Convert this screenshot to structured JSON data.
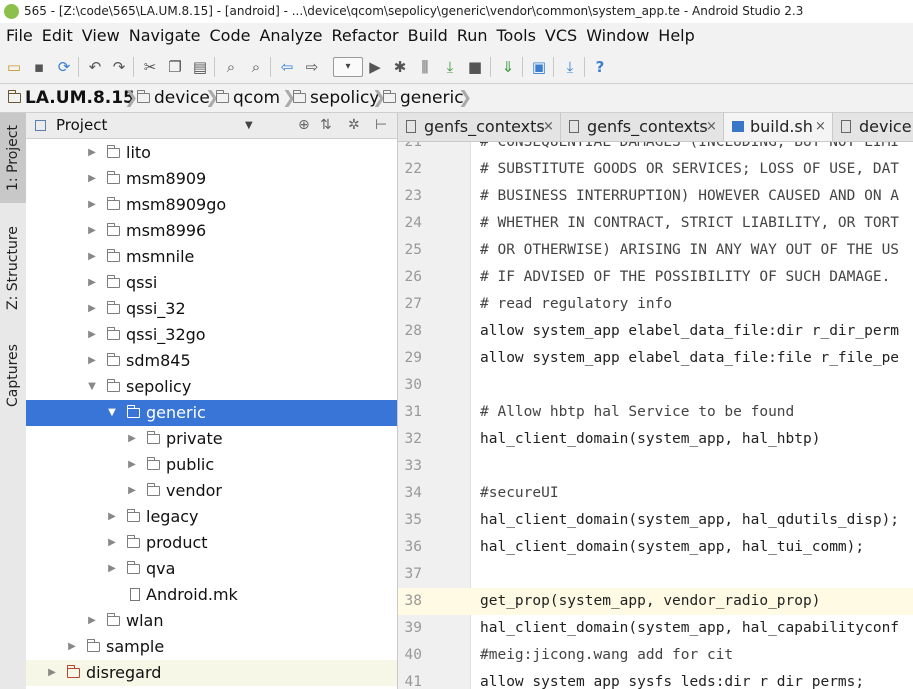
{
  "window": {
    "title": "565 - [Z:\\code\\565\\LA.UM.8.15] - [android] - ...\\device\\qcom\\sepolicy\\generic\\vendor\\common\\system_app.te - Android Studio 2.3"
  },
  "menu": [
    "File",
    "Edit",
    "View",
    "Navigate",
    "Code",
    "Analyze",
    "Refactor",
    "Build",
    "Run",
    "Tools",
    "VCS",
    "Window",
    "Help"
  ],
  "breadcrumb": [
    "LA.UM.8.15",
    "device",
    "qcom",
    "sepolicy",
    "generic"
  ],
  "side_tabs": [
    "1: Project",
    "Z: Structure",
    "Captures"
  ],
  "project_panel": {
    "title": "Project"
  },
  "tree": [
    {
      "label": "lito",
      "depth": 3,
      "type": "folder",
      "state": "collapsed"
    },
    {
      "label": "msm8909",
      "depth": 3,
      "type": "folder",
      "state": "collapsed"
    },
    {
      "label": "msm8909go",
      "depth": 3,
      "type": "folder",
      "state": "collapsed"
    },
    {
      "label": "msm8996",
      "depth": 3,
      "type": "folder",
      "state": "collapsed"
    },
    {
      "label": "msmnile",
      "depth": 3,
      "type": "folder",
      "state": "collapsed"
    },
    {
      "label": "qssi",
      "depth": 3,
      "type": "folder",
      "state": "collapsed"
    },
    {
      "label": "qssi_32",
      "depth": 3,
      "type": "folder",
      "state": "collapsed"
    },
    {
      "label": "qssi_32go",
      "depth": 3,
      "type": "folder",
      "state": "collapsed"
    },
    {
      "label": "sdm845",
      "depth": 3,
      "type": "folder",
      "state": "collapsed"
    },
    {
      "label": "sepolicy",
      "depth": 3,
      "type": "folder",
      "state": "expanded"
    },
    {
      "label": "generic",
      "depth": 4,
      "type": "folder",
      "state": "expanded",
      "selected": true
    },
    {
      "label": "private",
      "depth": 5,
      "type": "folder",
      "state": "collapsed"
    },
    {
      "label": "public",
      "depth": 5,
      "type": "folder",
      "state": "collapsed"
    },
    {
      "label": "vendor",
      "depth": 5,
      "type": "folder",
      "state": "collapsed"
    },
    {
      "label": "legacy",
      "depth": 4,
      "type": "folder",
      "state": "collapsed"
    },
    {
      "label": "product",
      "depth": 4,
      "type": "folder",
      "state": "collapsed"
    },
    {
      "label": "qva",
      "depth": 4,
      "type": "folder",
      "state": "collapsed"
    },
    {
      "label": "Android.mk",
      "depth": 4,
      "type": "file",
      "state": "none"
    },
    {
      "label": "wlan",
      "depth": 3,
      "type": "folder",
      "state": "collapsed"
    },
    {
      "label": "sample",
      "depth": 2,
      "type": "folder",
      "state": "collapsed"
    },
    {
      "label": "disregard",
      "depth": 1,
      "type": "folder",
      "state": "collapsed",
      "excluded": true
    }
  ],
  "tabs": [
    {
      "label": "genfs_contexts",
      "icon": "text-file-icon"
    },
    {
      "label": "genfs_contexts",
      "icon": "text-file-icon"
    },
    {
      "label": "build.sh",
      "icon": "shell-script-icon"
    },
    {
      "label": "device.",
      "icon": "text-file-icon"
    }
  ],
  "editor": {
    "current_line": 38,
    "lines": [
      {
        "num": "21",
        "text": "# CONSEQUENTIAL DAMAGES (INCLUDING, BUT NOT LIMI"
      },
      {
        "num": "22",
        "text": "# SUBSTITUTE GOODS OR SERVICES; LOSS OF USE, DAT"
      },
      {
        "num": "23",
        "text": "# BUSINESS INTERRUPTION) HOWEVER CAUSED AND ON A"
      },
      {
        "num": "24",
        "text": "# WHETHER IN CONTRACT, STRICT LIABILITY, OR TORT"
      },
      {
        "num": "25",
        "text": "# OR OTHERWISE) ARISING IN ANY WAY OUT OF THE US"
      },
      {
        "num": "26",
        "text": "# IF ADVISED OF THE POSSIBILITY OF SUCH DAMAGE."
      },
      {
        "num": "27",
        "text": "# read regulatory info"
      },
      {
        "num": "28",
        "text": "allow system_app elabel_data_file:dir r_dir_perm"
      },
      {
        "num": "29",
        "text": "allow system_app elabel_data_file:file r_file_pe"
      },
      {
        "num": "30",
        "text": ""
      },
      {
        "num": "31",
        "text": "# Allow hbtp hal Service to be found"
      },
      {
        "num": "32",
        "text": "hal_client_domain(system_app, hal_hbtp)"
      },
      {
        "num": "33",
        "text": ""
      },
      {
        "num": "34",
        "text": "#secureUI"
      },
      {
        "num": "35",
        "text": "hal_client_domain(system_app, hal_qdutils_disp);"
      },
      {
        "num": "36",
        "text": "hal_client_domain(system_app, hal_tui_comm);"
      },
      {
        "num": "37",
        "text": ""
      },
      {
        "num": "38",
        "text": "get_prop(system_app, vendor_radio_prop)"
      },
      {
        "num": "39",
        "text": "hal_client_domain(system_app, hal_capabilityconf"
      },
      {
        "num": "40",
        "text": "#meig:jicong.wang add for cit"
      },
      {
        "num": "41",
        "text": "allow system_app sysfs_leds:dir r_dir_perms;"
      }
    ]
  }
}
